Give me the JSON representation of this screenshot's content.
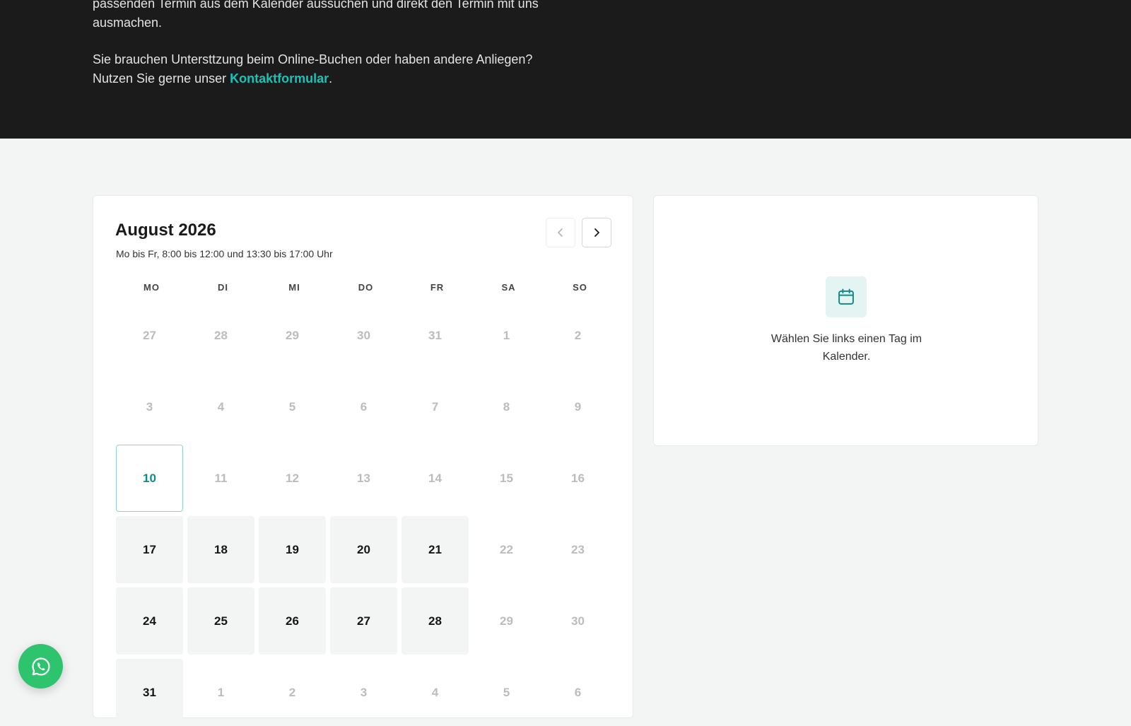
{
  "hero": {
    "paragraph1": "passenden Termin aus dem Kalender aussuchen und direkt den Termin mit uns ausmachen.",
    "paragraph2_line1": "Sie brauchen Untersttzung beim Online-Buchen oder haben andere Anliegen?",
    "paragraph2_prefix": "Nutzen Sie gerne unser ",
    "contact_link": "Kontaktformular",
    "paragraph2_suffix": "."
  },
  "calendar": {
    "title": "August 2026",
    "hours": "Mo bis Fr, 8:00 bis 12:00 und 13:30 bis 17:00 Uhr",
    "weekdays": [
      "MO",
      "DI",
      "MI",
      "DO",
      "FR",
      "SA",
      "SO"
    ],
    "prev_icon": "chevron-left-icon",
    "next_icon": "chevron-right-icon",
    "days": [
      {
        "label": "27",
        "state": "muted"
      },
      {
        "label": "28",
        "state": "muted"
      },
      {
        "label": "29",
        "state": "muted"
      },
      {
        "label": "30",
        "state": "muted"
      },
      {
        "label": "31",
        "state": "muted"
      },
      {
        "label": "1",
        "state": "muted"
      },
      {
        "label": "2",
        "state": "muted"
      },
      {
        "label": "3",
        "state": "muted"
      },
      {
        "label": "4",
        "state": "muted"
      },
      {
        "label": "5",
        "state": "muted"
      },
      {
        "label": "6",
        "state": "muted"
      },
      {
        "label": "7",
        "state": "muted"
      },
      {
        "label": "8",
        "state": "muted"
      },
      {
        "label": "9",
        "state": "muted"
      },
      {
        "label": "10",
        "state": "today"
      },
      {
        "label": "11",
        "state": "muted"
      },
      {
        "label": "12",
        "state": "muted"
      },
      {
        "label": "13",
        "state": "muted"
      },
      {
        "label": "14",
        "state": "muted"
      },
      {
        "label": "15",
        "state": "muted"
      },
      {
        "label": "16",
        "state": "muted"
      },
      {
        "label": "17",
        "state": "available"
      },
      {
        "label": "18",
        "state": "available"
      },
      {
        "label": "19",
        "state": "available"
      },
      {
        "label": "20",
        "state": "available"
      },
      {
        "label": "21",
        "state": "available"
      },
      {
        "label": "22",
        "state": "muted"
      },
      {
        "label": "23",
        "state": "muted"
      },
      {
        "label": "24",
        "state": "available"
      },
      {
        "label": "25",
        "state": "available"
      },
      {
        "label": "26",
        "state": "available"
      },
      {
        "label": "27",
        "state": "available"
      },
      {
        "label": "28",
        "state": "available"
      },
      {
        "label": "29",
        "state": "muted"
      },
      {
        "label": "30",
        "state": "muted"
      },
      {
        "label": "31",
        "state": "available"
      },
      {
        "label": "1",
        "state": "muted"
      },
      {
        "label": "2",
        "state": "muted"
      },
      {
        "label": "3",
        "state": "muted"
      },
      {
        "label": "4",
        "state": "muted"
      },
      {
        "label": "5",
        "state": "muted"
      },
      {
        "label": "6",
        "state": "muted"
      }
    ]
  },
  "info": {
    "icon": "calendar-icon",
    "text": "Wählen Sie links einen Tag im Kalender."
  },
  "whatsapp": {
    "icon": "whatsapp-icon"
  },
  "colors": {
    "accent": "#17c3b7",
    "today": "#0f8a8a",
    "whatsapp": "#2ec46e",
    "hero_bg": "#1b1b1b"
  }
}
